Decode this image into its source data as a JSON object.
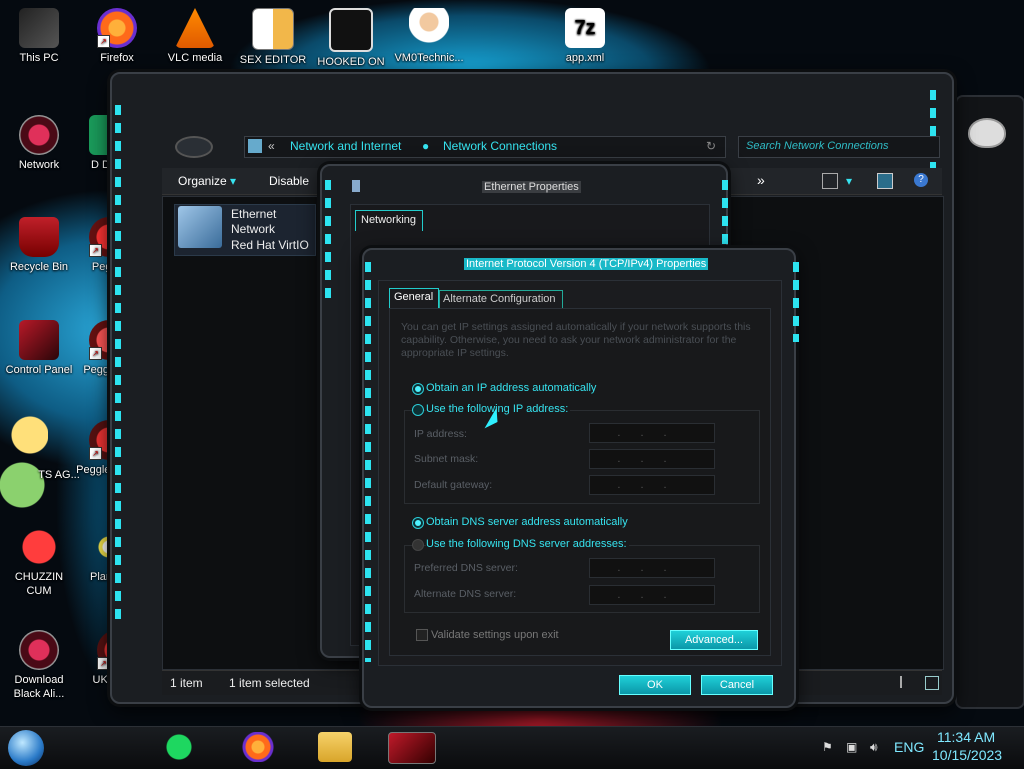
{
  "desktop": {
    "icons": [
      {
        "label": "This PC"
      },
      {
        "label": "Firefox"
      },
      {
        "label": "VLC media"
      },
      {
        "label": "SEX EDITOR"
      },
      {
        "label": "HOOKED ON"
      },
      {
        "label": "VM0Technic..."
      },
      {
        "label": "app.xml"
      },
      {
        "label": "Network"
      },
      {
        "label": "D DUM"
      },
      {
        "label": "Recycle Bin"
      },
      {
        "label": "Peggle"
      },
      {
        "label": "Control Panel"
      },
      {
        "label": "Peggle De"
      },
      {
        "label": "TS AG..."
      },
      {
        "label": "Peggle of Wa"
      },
      {
        "label": "CHUZZIN CUM"
      },
      {
        "label": "Plan Zo"
      },
      {
        "label": "Download Black Ali..."
      },
      {
        "label": "UKRAINE"
      }
    ]
  },
  "explorer": {
    "breadcrumb_root": "Network and Internet",
    "breadcrumb_current": "Network Connections",
    "search_placeholder": "Search Network Connections",
    "toolbar": {
      "organize": "Organize",
      "disable": "Disable",
      "more": "»"
    },
    "adapter": {
      "name": "Ethernet",
      "network": "Network",
      "device": "Red Hat VirtIO E"
    },
    "status": {
      "count": "1 item",
      "selected": "1 item selected"
    }
  },
  "ethernet_props": {
    "title": "Ethernet Properties",
    "tab": "Networking"
  },
  "ipv4": {
    "title": "Internet Protocol Version 4 (TCP/IPv4) Properties",
    "tabs": [
      "General",
      "Alternate Configuration"
    ],
    "intro": "You can get IP settings assigned automatically if your network supports this capability. Otherwise, you need to ask your network administrator for the appropriate IP settings.",
    "auto_ip": "Obtain an IP address automatically",
    "manual_ip": "Use the following IP address:",
    "ip_label": "IP address:",
    "mask_label": "Subnet mask:",
    "gw_label": "Default gateway:",
    "auto_dns": "Obtain DNS server address automatically",
    "manual_dns": "Use the following DNS server addresses:",
    "pref_dns": "Preferred DNS server:",
    "alt_dns": "Alternate DNS server:",
    "ip_placeholder": "...",
    "validate": "Validate settings upon exit",
    "advanced": "Advanced...",
    "ok": "OK",
    "cancel": "Cancel"
  },
  "taskbar": {
    "lang": "ENG",
    "time": "11:34 AM",
    "date": "10/15/2023"
  },
  "colors": {
    "accent": "#36e3ef",
    "frame": "#1b1e22"
  }
}
